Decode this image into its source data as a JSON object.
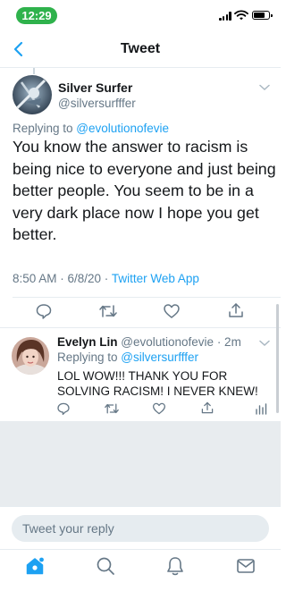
{
  "status_bar": {
    "time": "12:29"
  },
  "header": {
    "title": "Tweet"
  },
  "tweet": {
    "name": "Silver Surfer",
    "handle": "@silversurfffer",
    "replying_label": "Replying to ",
    "replying_to": "@evolutionofevie",
    "text": "You know the answer to racism is being nice to everyone and just being better people. You seem to be in a very dark place now I hope you get better.",
    "timestamp": "8:50 AM · 6/8/20 · ",
    "source": "Twitter Web App"
  },
  "reply": {
    "name": "Evelyn Lin",
    "handle_time": "@evolutionofevie · 2m",
    "replying_label": "Replying to ",
    "replying_to": "@silversurfffer",
    "text": "LOL WOW!!! THANK YOU FOR SOLVING RACISM! I NEVER KNEW!"
  },
  "compose": {
    "placeholder": "Tweet your reply"
  },
  "colors": {
    "accent": "#1da1f2",
    "secondary_text": "#657786",
    "status_pill": "#2fb24c"
  },
  "icons": {
    "tweet_actions": [
      "reply-icon",
      "retweet-icon",
      "like-icon",
      "share-icon"
    ],
    "reply_actions": [
      "reply-icon",
      "retweet-icon",
      "like-icon",
      "share-icon",
      "analytics-icon"
    ],
    "tabs": [
      "home-icon",
      "search-icon",
      "notifications-icon",
      "messages-icon"
    ]
  }
}
